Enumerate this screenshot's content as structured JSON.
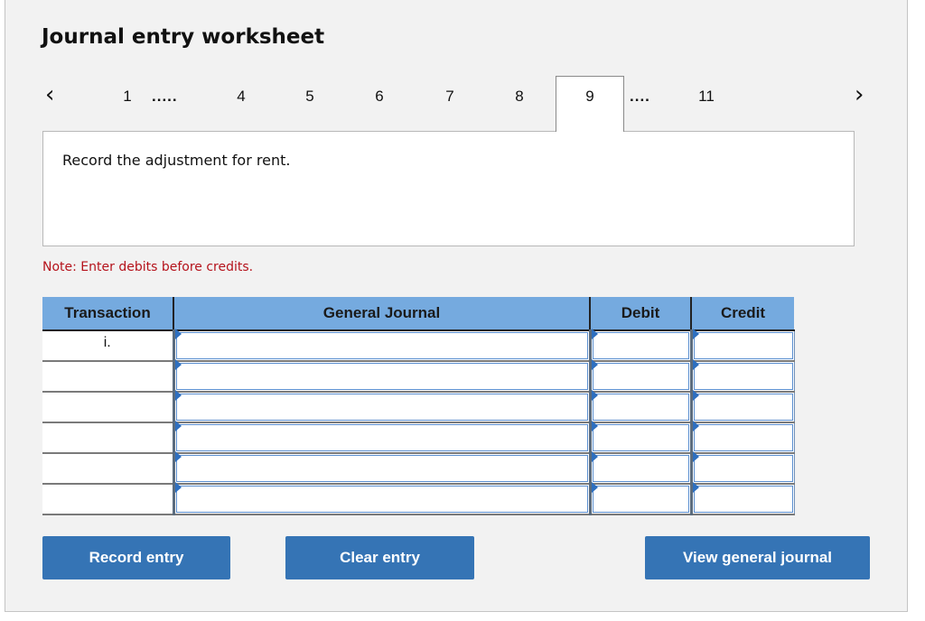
{
  "worksheet": {
    "title": "Journal entry worksheet",
    "nav": {
      "prev_icon": "chevron-left-icon",
      "next_icon": "chevron-right-icon",
      "prev_glyph": "‹",
      "next_glyph": "›"
    },
    "tabs": [
      {
        "label": "1",
        "active": false
      },
      {
        "label": "4",
        "active": false
      },
      {
        "label": "5",
        "active": false
      },
      {
        "label": "6",
        "active": false
      },
      {
        "label": "7",
        "active": false
      },
      {
        "label": "8",
        "active": false
      },
      {
        "label": "9",
        "active": true
      },
      {
        "label": "11",
        "active": false
      }
    ],
    "ellipsis_after_1": ".....",
    "ellipsis_after_9": "....",
    "prompt": "Record the adjustment for rent.",
    "note": "Note: Enter debits before credits.",
    "note_color": "#b5121b",
    "table": {
      "headers": {
        "transaction": "Transaction",
        "general_journal": "General Journal",
        "debit": "Debit",
        "credit": "Credit"
      },
      "header_color": "#75aadf",
      "rows": [
        {
          "transaction": "i.",
          "account": "",
          "debit": "",
          "credit": ""
        },
        {
          "transaction": "",
          "account": "",
          "debit": "",
          "credit": ""
        },
        {
          "transaction": "",
          "account": "",
          "debit": "",
          "credit": ""
        },
        {
          "transaction": "",
          "account": "",
          "debit": "",
          "credit": ""
        },
        {
          "transaction": "",
          "account": "",
          "debit": "",
          "credit": ""
        },
        {
          "transaction": "",
          "account": "",
          "debit": "",
          "credit": ""
        }
      ]
    },
    "buttons": {
      "record_entry": "Record entry",
      "clear_entry": "Clear entry",
      "view_general_journal": "View general journal"
    },
    "button_color": "#3574b5"
  }
}
